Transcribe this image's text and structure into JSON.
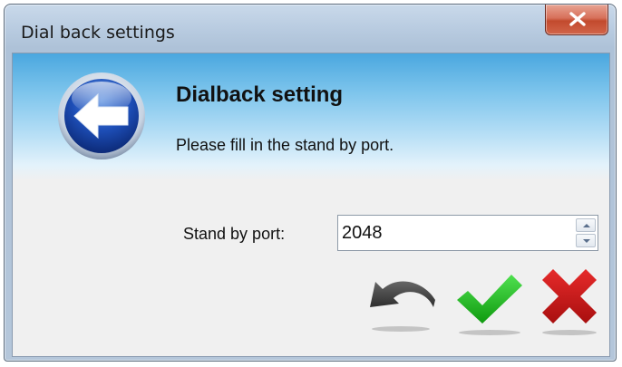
{
  "window": {
    "title": "Dial back settings"
  },
  "header": {
    "title": "Dialback setting",
    "subtitle": "Please fill in the stand by port."
  },
  "form": {
    "port_label": "Stand by port:",
    "port_value": "2048"
  },
  "icons": {
    "logo": "back-arrow-icon",
    "close": "close-icon",
    "spin_up": "spin-up-icon",
    "spin_down": "spin-down-icon",
    "undo": "undo-icon",
    "ok": "checkmark-icon",
    "cancel": "cancel-x-icon"
  },
  "colors": {
    "banner_top": "#4aa7df",
    "ok_green": "#1db51d",
    "cancel_red": "#c81515",
    "undo_dark": "#3a3a3a",
    "close_red": "#c24a2d"
  }
}
